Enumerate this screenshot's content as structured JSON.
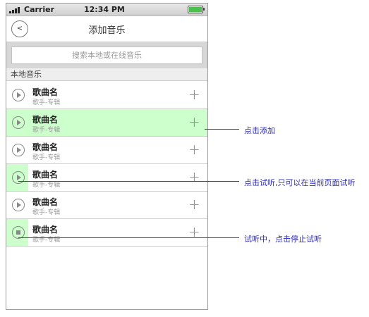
{
  "status": {
    "carrier": "Carrier",
    "time": "12:34 PM"
  },
  "nav": {
    "back_label": "<",
    "title": "添加音乐"
  },
  "search": {
    "placeholder": "搜索本地或在线音乐"
  },
  "section": {
    "title": "本地音乐"
  },
  "songs": [
    {
      "title": "歌曲名",
      "sub": "歌手-专辑",
      "state": "idle"
    },
    {
      "title": "歌曲名",
      "sub": "歌手-专辑",
      "state": "selected"
    },
    {
      "title": "歌曲名",
      "sub": "歌手-专辑",
      "state": "idle"
    },
    {
      "title": "歌曲名",
      "sub": "歌手-专辑",
      "state": "previewing-play"
    },
    {
      "title": "歌曲名",
      "sub": "歌手-专辑",
      "state": "idle"
    },
    {
      "title": "歌曲名",
      "sub": "歌手-专辑",
      "state": "previewing-stop"
    }
  ],
  "annotations": {
    "add": "点击添加",
    "preview": "点击试听,只可以在当前页面试听",
    "stop": "试听中，点击停止试听"
  },
  "colors": {
    "highlight": "#ccffcc",
    "annotation": "#3b3bd6",
    "battery": "#4bc24b"
  }
}
